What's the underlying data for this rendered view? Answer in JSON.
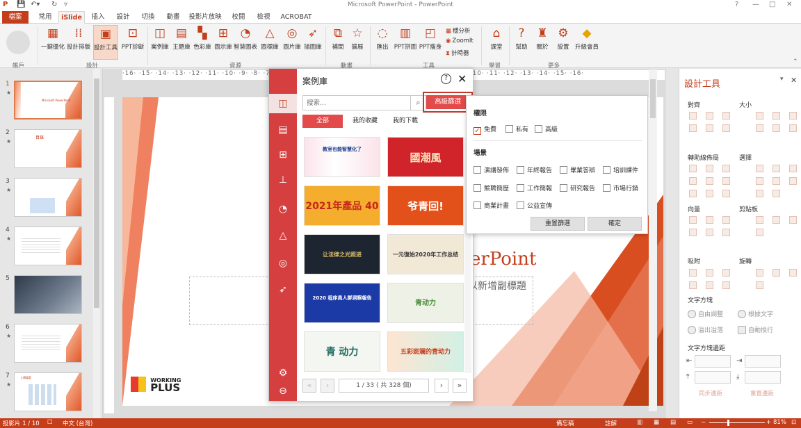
{
  "titlebar": {
    "title": "Microsoft PowerPoint - PowerPoint",
    "help": "?",
    "minimize": "—",
    "restore": "□",
    "close": "✕"
  },
  "tabs": [
    "檔案",
    "常用",
    "iSlide",
    "插入",
    "設計",
    "切換",
    "動畫",
    "投影片放映",
    "校閱",
    "檢視",
    "ACROBAT"
  ],
  "ribbon": {
    "buttons": [
      {
        "label": "一鍵優化",
        "icon": "optimize-icon"
      },
      {
        "label": "設計排版",
        "icon": "layout-icon"
      },
      {
        "label": "設計工具",
        "icon": "design-tools-icon"
      },
      {
        "label": "PPT診斷",
        "icon": "diagnose-icon"
      },
      {
        "label": "案例庫",
        "icon": "case-library-icon"
      },
      {
        "label": "主題庫",
        "icon": "theme-library-icon"
      },
      {
        "label": "色彩庫",
        "icon": "color-library-icon"
      },
      {
        "label": "圖示庫",
        "icon": "diagram-library-icon"
      },
      {
        "label": "智慧圖表",
        "icon": "smart-chart-icon"
      },
      {
        "label": "圖標庫",
        "icon": "icon-library-icon"
      },
      {
        "label": "圖片庫",
        "icon": "image-library-icon"
      },
      {
        "label": "插圖庫",
        "icon": "illustration-library-icon"
      },
      {
        "label": "補間",
        "icon": "tween-icon"
      },
      {
        "label": "擴展",
        "icon": "extend-icon"
      },
      {
        "label": "匯出",
        "icon": "export-icon"
      },
      {
        "label": "PPT拼圖",
        "icon": "puzzle-icon"
      },
      {
        "label": "PPT瘦身",
        "icon": "slim-icon"
      },
      {
        "label": "課堂",
        "icon": "classroom-icon"
      },
      {
        "label": "幫助",
        "icon": "help-icon"
      },
      {
        "label": "關於",
        "icon": "about-icon"
      },
      {
        "label": "設置",
        "icon": "settings-icon"
      },
      {
        "label": "升級會員",
        "icon": "upgrade-icon"
      }
    ],
    "small_buttons": [
      "穩分析",
      "ZoomIt",
      "計時器"
    ],
    "groups": [
      "帳戶",
      "設計",
      "資源",
      "動畫",
      "工具",
      "學習",
      "更多"
    ]
  },
  "ruler_text": "·16·  ·15·  ·14·  ·13·  ·12·  ·11·  ·10·  ·9·  ·8·  ·7·  ·6·  ·5·  ·4·  ·3·  ·2·  ·1·  ·0·  ·1·  ·2·  ·3·  ·4·  ·5·  ·6·  ·7·  ·8·  ·9·  ·10·  ·11·  ·12·  ·13·  ·14·  ·15·  ·16·",
  "slides": [
    {
      "num": "1",
      "heading": "Microsoft PowerPoint"
    },
    {
      "num": "2",
      "heading": "目錄"
    },
    {
      "num": "3",
      "heading": ""
    },
    {
      "num": "4",
      "heading": ""
    },
    {
      "num": "5",
      "heading": ""
    },
    {
      "num": "6",
      "heading": ""
    },
    {
      "num": "7",
      "heading": "上傳檔案"
    }
  ],
  "slide_main": {
    "title_fragment": "erPoint",
    "subtitle_fragment": "以新增副標題",
    "logo_top": "WORKING",
    "logo_bottom": "PLUS"
  },
  "popup": {
    "title": "案例庫",
    "search_placeholder": "搜索...",
    "advanced_label": "高級篩選",
    "tabs": [
      "全部",
      "我的收藏",
      "我的下載"
    ],
    "cards": [
      {
        "text": "教室也能智慧化了"
      },
      {
        "text": "國潮風"
      },
      {
        "text": "2021年產品 40"
      },
      {
        "text": "爷青回!"
      },
      {
        "text": "让法律之光照进"
      },
      {
        "text": "一元復始2020年工作总结"
      },
      {
        "text": "2020 程序員人群洞察報告"
      },
      {
        "text": "青动力"
      },
      {
        "text": "青 动力"
      },
      {
        "text": "五彩斑斓的青动力"
      }
    ],
    "pager": "1 / 33 ( 共 328 個)"
  },
  "filter": {
    "perm_label": "權限",
    "perms": [
      {
        "label": "免費",
        "checked": true
      },
      {
        "label": "私有",
        "checked": false
      },
      {
        "label": "高級",
        "checked": false
      }
    ],
    "scene_label": "場景",
    "scenes": [
      "演講發佈",
      "年終報告",
      "畢業答辯",
      "培訓課件",
      "競聘簡歷",
      "工作簡報",
      "研究報告",
      "市場行銷",
      "商業計畫",
      "公益宣傳"
    ],
    "reset_label": "重置篩選",
    "ok_label": "確定"
  },
  "rpanel": {
    "title": "設計工具",
    "pin": "▾",
    "close": "✕",
    "sections": [
      "對齊",
      "大小",
      "轉助線佈局",
      "選擇",
      "向量",
      "剪貼板",
      "吸附",
      "旋轉"
    ],
    "text_dir_label": "文字方塊",
    "radios": [
      "自由調整",
      "溢出溢落",
      "根據文字",
      "自動換行"
    ],
    "margin_label": "文字方塊邊距",
    "bottom_links": [
      "同步邊距",
      "重置邊距"
    ]
  },
  "status": {
    "slide_pos": "投影片 1 / 10",
    "lang": "中文 (台灣)",
    "notes": "備忘稿",
    "comments": "註解",
    "zoom": "81%"
  }
}
